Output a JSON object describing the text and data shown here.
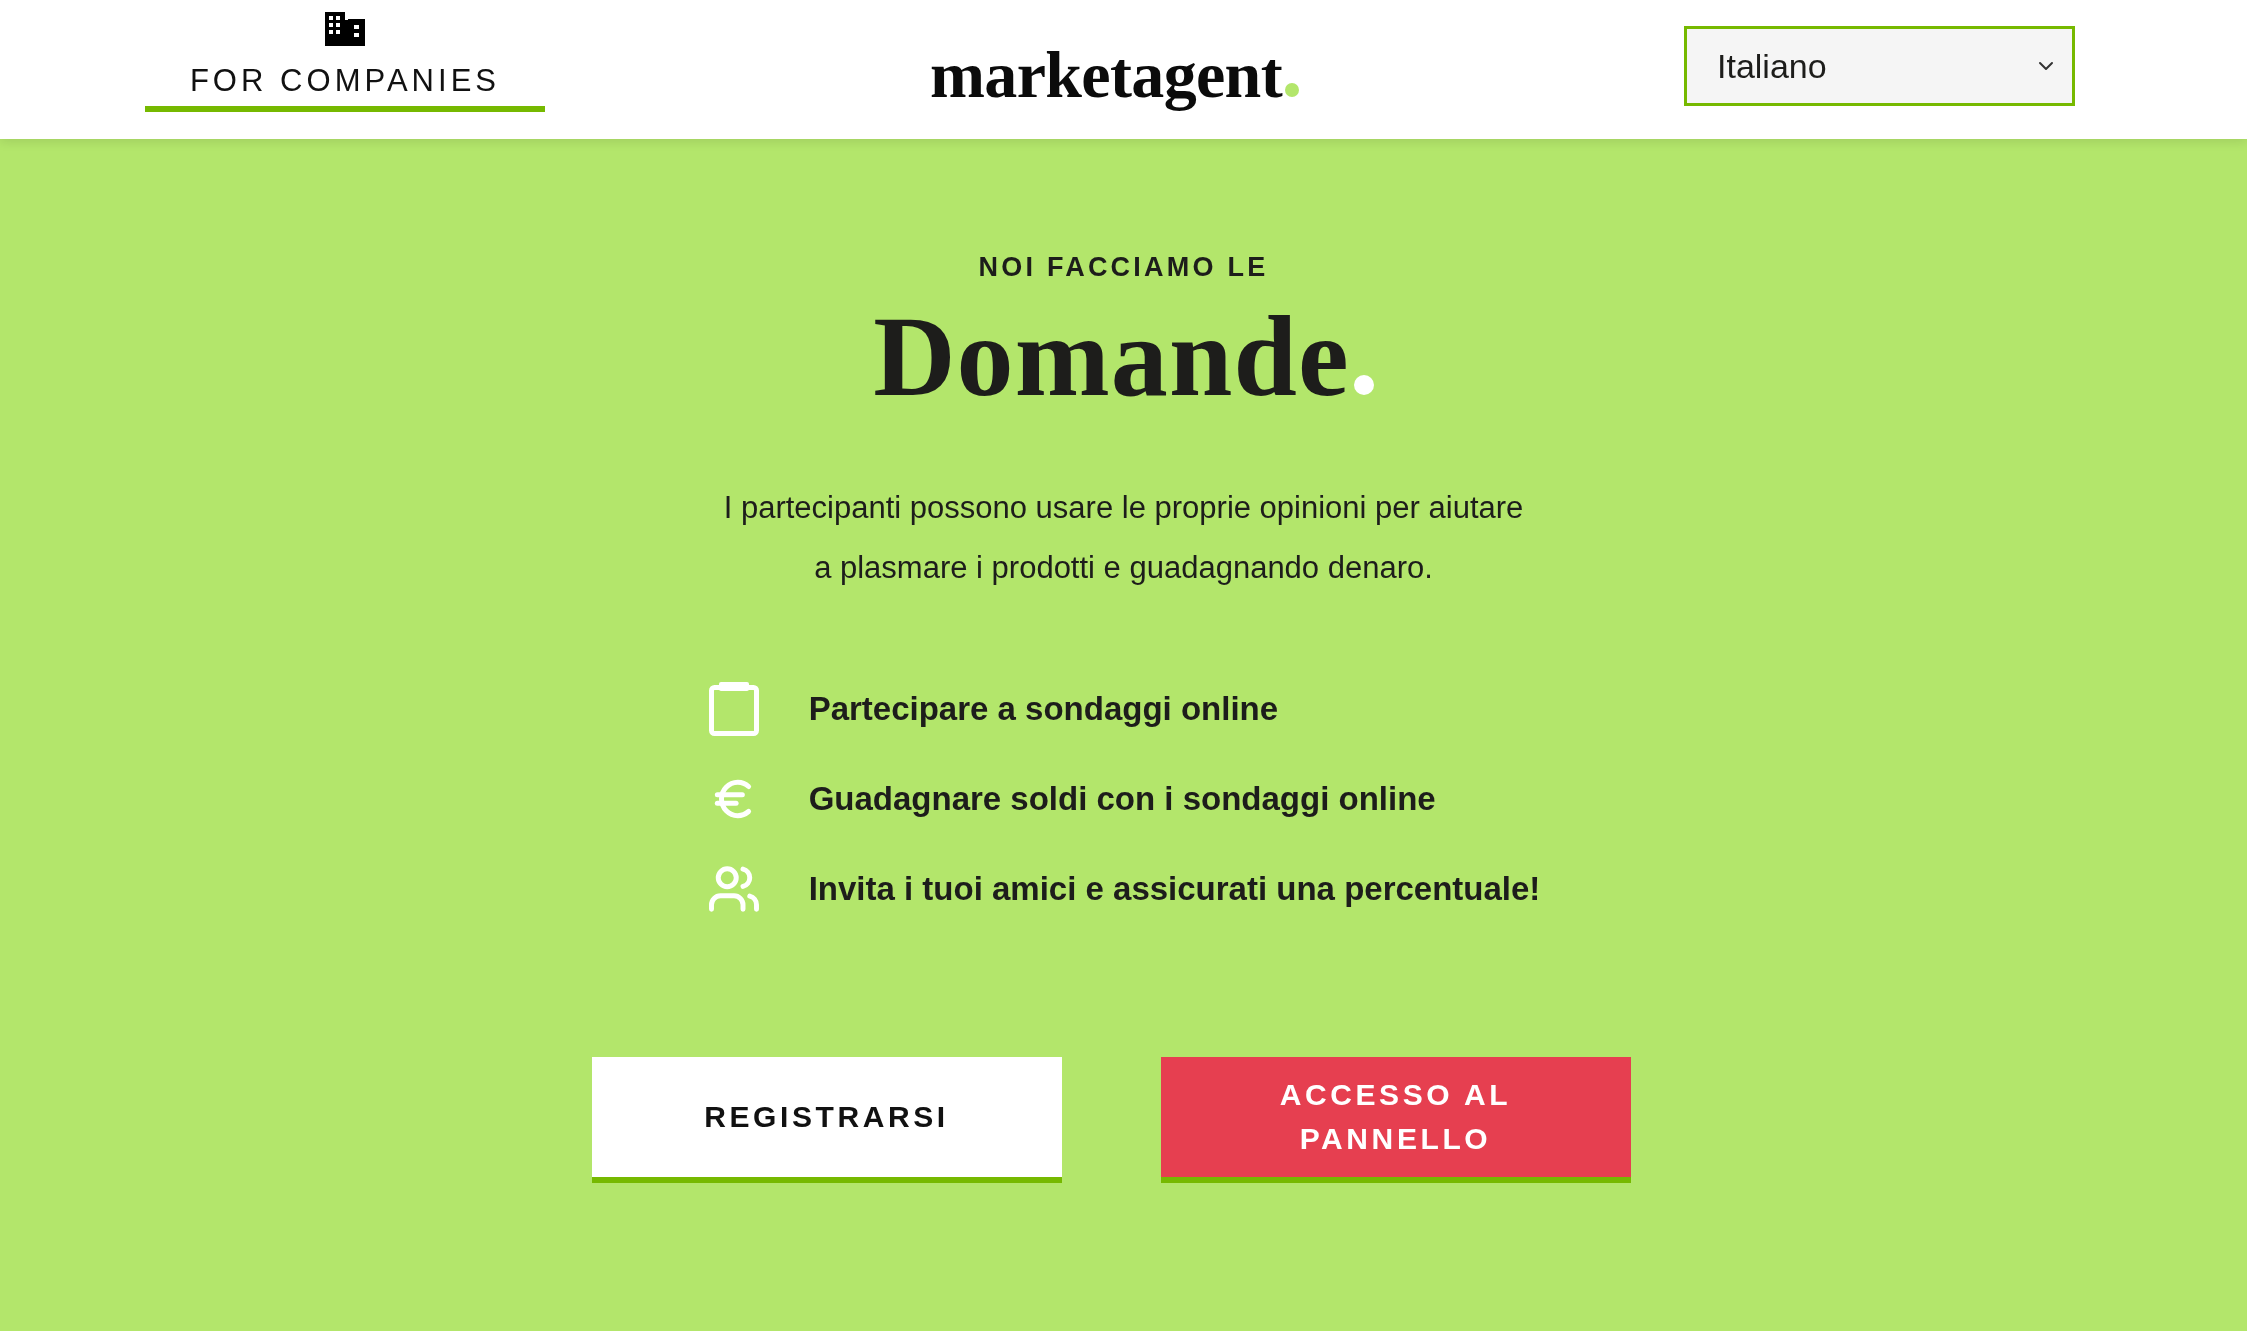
{
  "header": {
    "companies_link": "FOR COMPANIES",
    "logo": "marketagent",
    "language_select": {
      "value": "Italiano"
    }
  },
  "hero": {
    "eyebrow": "NOI FACCIAMO LE",
    "title": "Domande",
    "description": "I partecipanti possono usare le proprie opinioni per aiutare a plasmare i prodotti e guadagnando denaro.",
    "features": [
      {
        "kind": "clipboard",
        "label": "Partecipare a sondaggi online"
      },
      {
        "kind": "euro",
        "label": "Guadagnare soldi con i sondaggi online"
      },
      {
        "kind": "users",
        "label": "Invita i tuoi amici e assicurati una percentuale!"
      }
    ],
    "buttons": [
      {
        "kind": "secondary",
        "label": "REGISTRARSI"
      },
      {
        "kind": "primary",
        "label": "ACCESSO AL PANNELLO"
      }
    ]
  }
}
